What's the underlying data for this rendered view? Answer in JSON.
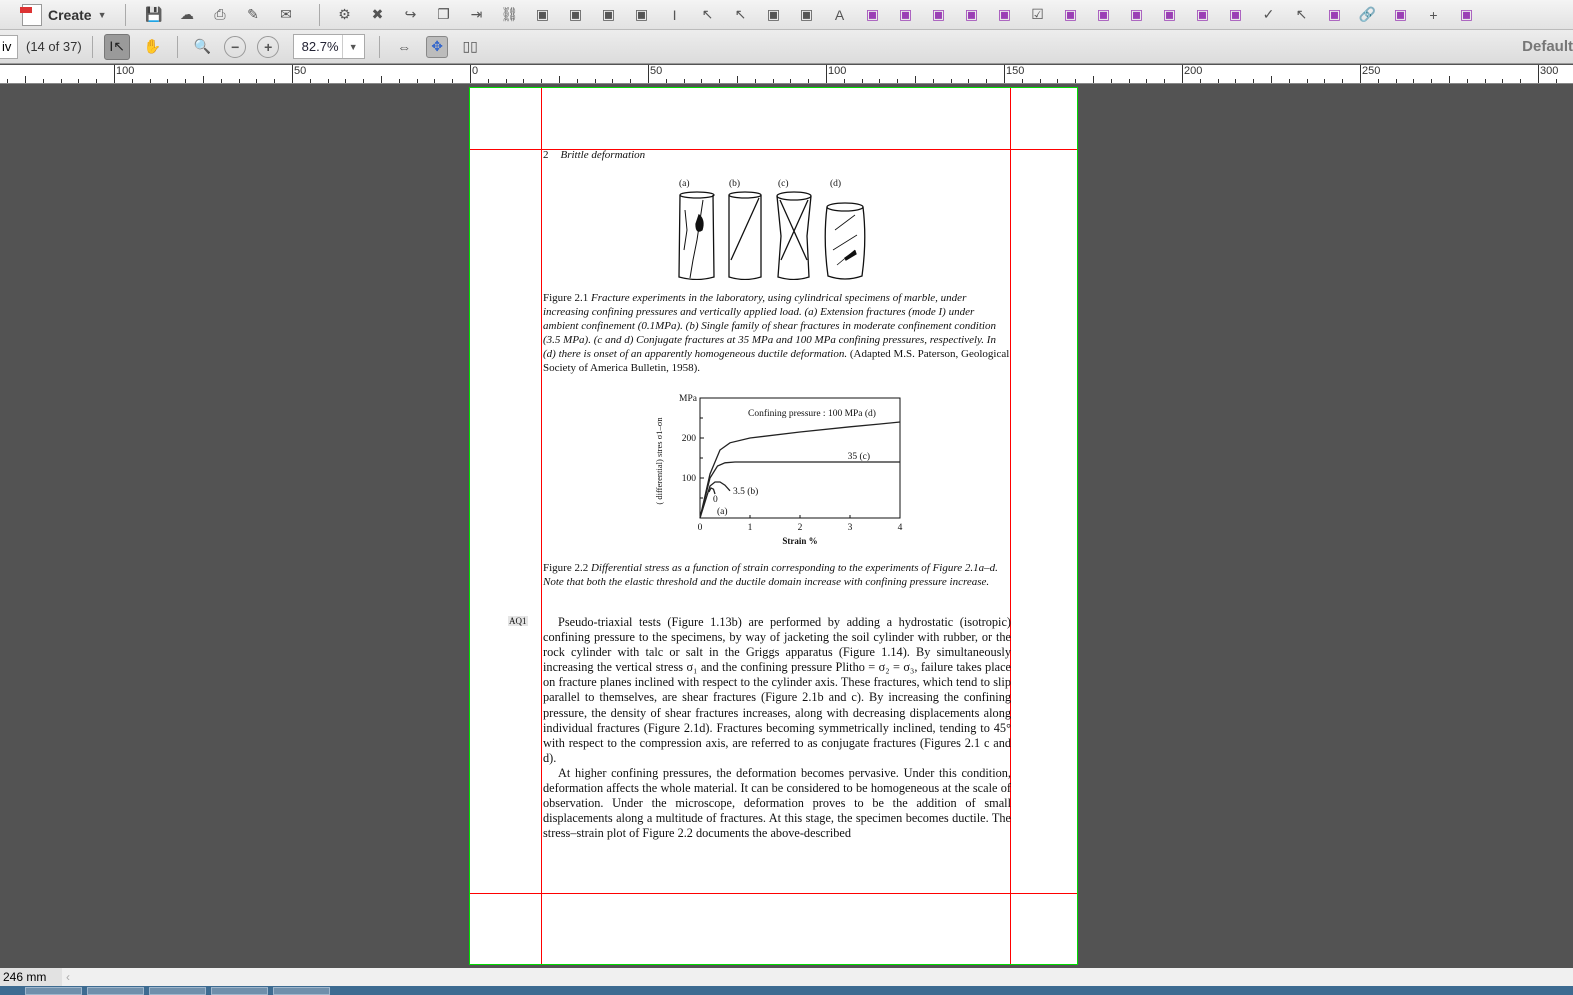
{
  "toolbar": {
    "create_label": "Create",
    "icons": [
      "save-icon",
      "cloud-upload-icon",
      "print-icon",
      "edit-form-icon",
      "email-icon",
      "gear-icon",
      "delete-page-icon",
      "open-icon",
      "copy-icon",
      "export-icon",
      "unlink-icon",
      "search-replace-icon",
      "insert-icon",
      "download-icon",
      "color-bars-icon",
      "text-cursor-icon",
      "select-arrow-icon",
      "select-object-icon",
      "shape-icon",
      "rectangle-icon",
      "text-a-icon",
      "baseline-icon",
      "pen-icon",
      "pin-icon",
      "measure-icon",
      "field-icon",
      "checkbox-icon",
      "radio-icon",
      "image-field-icon",
      "button-field-icon",
      "text-field-icon",
      "comment-icon",
      "list-icon",
      "check-icon",
      "pointer-icon",
      "page-number-icon",
      "link-icon",
      "crop-icon",
      "crosshair-icon",
      "preflight-icon"
    ],
    "page_input_value": "iv",
    "page_count": "(14 of 37)",
    "zoom_value": "82.7%",
    "right_label": "Default"
  },
  "ruler": {
    "labels": [
      "100",
      "50",
      "0",
      "50",
      "100",
      "150",
      "200",
      "250",
      "300"
    ]
  },
  "document": {
    "running_head_number": "2",
    "running_head_title": "Brittle deformation",
    "figure1": {
      "panel_labels": [
        "(a)",
        "(b)",
        "(c)",
        "(d)"
      ],
      "caption_label": "Figure 2.1",
      "caption_italic": "Fracture experiments in the laboratory, using cylindrical specimens of marble, under increasing confining pressures and vertically applied load. (a) Extension fractures (mode I) under ambient confinement (0.1MPa). (b) Single family of shear fractures in moderate confinement condition (3.5 MPa). (c and d) Conjugate fractures at 35 MPa and 100 MPa confining pressures, respectively. In (d) there is onset of an apparently homogeneous ductile deformation.",
      "caption_source": "(Adapted M.S. Paterson, Geological Society of America Bulletin, 1958)."
    },
    "figure2": {
      "caption_label": "Figure 2.2",
      "caption_italic": "Differential stress as a function of strain corresponding to the experiments of Figure 2.1a–d. Note that both the elastic threshold and the ductile domain increase with confining pressure increase."
    },
    "query_tag": "AQ1",
    "paragraph1": "Pseudo-triaxial tests (Figure 1.13b) are performed by adding a hydrostatic (isotropic) confining pressure to the specimens, by way of jacketing the soil cylinder with rubber, or the rock cylinder with talc or salt in the Griggs apparatus (Figure 1.14). By simultaneously increasing the vertical stress σ₁ and the confining pressure Plitho = σ₂ = σ₃, failure takes place on fracture planes inclined with respect to the cylinder axis. These fractures, which tend to slip parallel to themselves, are shear fractures (Figure 2.1b and c). By increasing the confining pressure, the density of shear fractures increases, along with decreasing displacements along individual fractures (Figure 2.1d). Fractures becoming symmetrically inclined, tending to 45° with respect to the compression axis, are referred to as conjugate fractures (Figures 2.1 c and d).",
    "paragraph2": "At higher confining pressures, the deformation becomes pervasive. Under this condition, deformation affects the whole material. It can be considered to be homogeneous at the scale of observation. Under the microscope, deformation proves to be the addition of small displacements along a multitude of fractures. At this stage, the specimen becomes ductile. The stress–strain plot of Figure 2.2 documents the above-described"
  },
  "chart_data": {
    "type": "line",
    "xlabel": "Strain %",
    "ylabel": "( differential) stres σ1–σn",
    "yunit": "MPa",
    "xlim": [
      0,
      4
    ],
    "ylim": [
      0,
      300
    ],
    "xticks": [
      "0",
      "1",
      "2",
      "3",
      "4"
    ],
    "yticks": [
      "100",
      "200"
    ],
    "series": [
      {
        "name": "Confining pressure : 100 MPa (d)",
        "x": [
          0,
          0.2,
          0.4,
          0.6,
          1,
          2,
          3,
          3.6,
          4
        ],
        "y": [
          0,
          110,
          170,
          188,
          200,
          215,
          228,
          235,
          240
        ]
      },
      {
        "name": "35 (c)",
        "x": [
          0,
          0.2,
          0.35,
          0.5,
          0.7,
          1,
          2,
          3,
          4
        ],
        "y": [
          0,
          100,
          130,
          138,
          140,
          140,
          140,
          140,
          140
        ]
      },
      {
        "name": "3.5 (b)",
        "x": [
          0,
          0.2,
          0.3,
          0.4,
          0.5,
          0.6
        ],
        "y": [
          0,
          80,
          90,
          90,
          82,
          68
        ]
      },
      {
        "name": "0",
        "x": [
          0.18,
          0.22,
          0.27,
          0.3
        ],
        "y": [
          65,
          75,
          72,
          60
        ]
      }
    ],
    "annotation": "(a)"
  },
  "status": {
    "page_size": "246 mm"
  }
}
